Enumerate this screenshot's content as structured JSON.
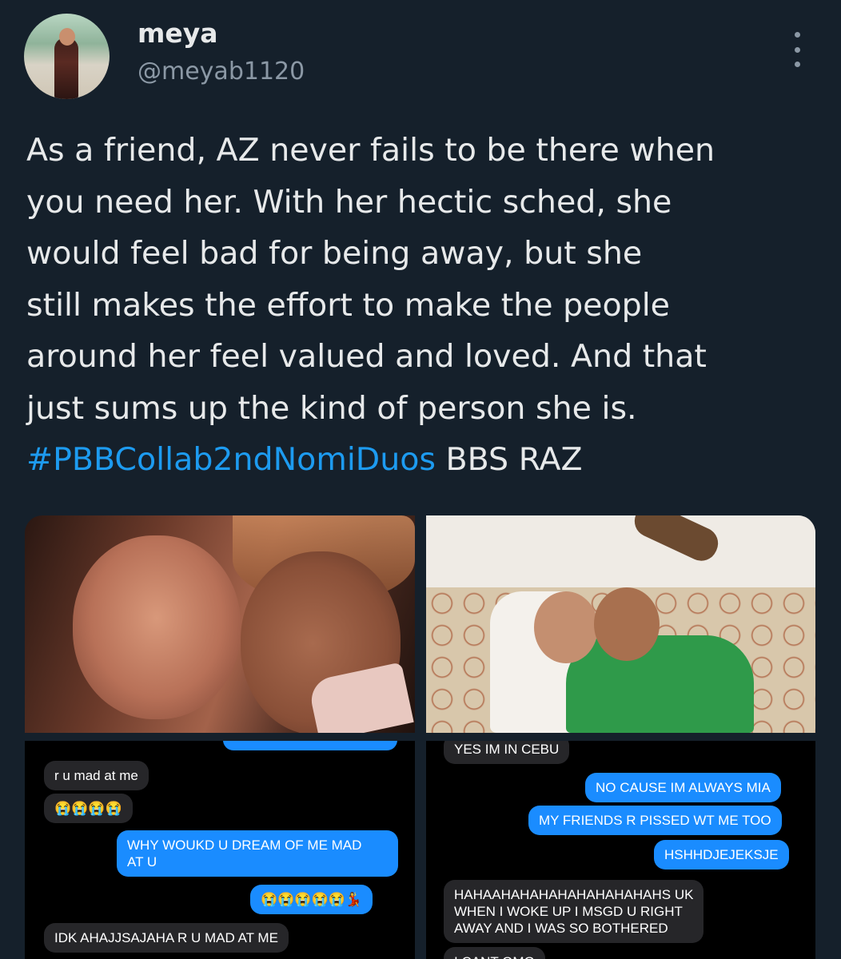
{
  "author": {
    "name": "meya",
    "handle": "@meyab1120",
    "avatar_icon": "profile-photo"
  },
  "more_icon": "more-options-icon",
  "tweet": {
    "lines": [
      "As a friend, AZ never fails to be there when",
      "you need her. With her hectic sched, she",
      "would feel bad for being away, but she",
      "still makes the effort to make the people",
      "around her feel valued and loved. And that",
      "just sums up the kind of person she is."
    ],
    "hashtag": "#PBBCollab2ndNomiDuos",
    "tail": " BBS RAZ"
  },
  "colors": {
    "background": "#15202b",
    "text": "#e7e9ea",
    "secondary": "#8b98a5",
    "link": "#1d9bf0",
    "imessage_blue": "#1a8cff",
    "imessage_gray": "#262629"
  },
  "chat_left": {
    "msg1": "r u mad at me",
    "msg2": "😭😭😭😭",
    "msg3_l1": "WHY WOUKD U DREAM OF ME MAD",
    "msg3_l2": "AT U",
    "msg4": "😭😭😭😭😭💃",
    "msg5": "IDK AHAJJSAJAHA R U MAD AT ME"
  },
  "chat_right": {
    "msg1": "YES IM IN CEBU",
    "msg2": "NO CAUSE IM ALWAYS MIA",
    "msg3": "MY FRIENDS R PISSED WT ME TOO",
    "msg4": "HSHHDJEJEKSJE",
    "msg5_l1": "HAHAAHAHAHAHAHAHAHAHAHS UK",
    "msg5_l2": "WHEN I WOKE UP I MSGD U RIGHT",
    "msg5_l3": "AWAY AND I WAS SO BOTHERED",
    "msg6": "I CANT OMG"
  }
}
